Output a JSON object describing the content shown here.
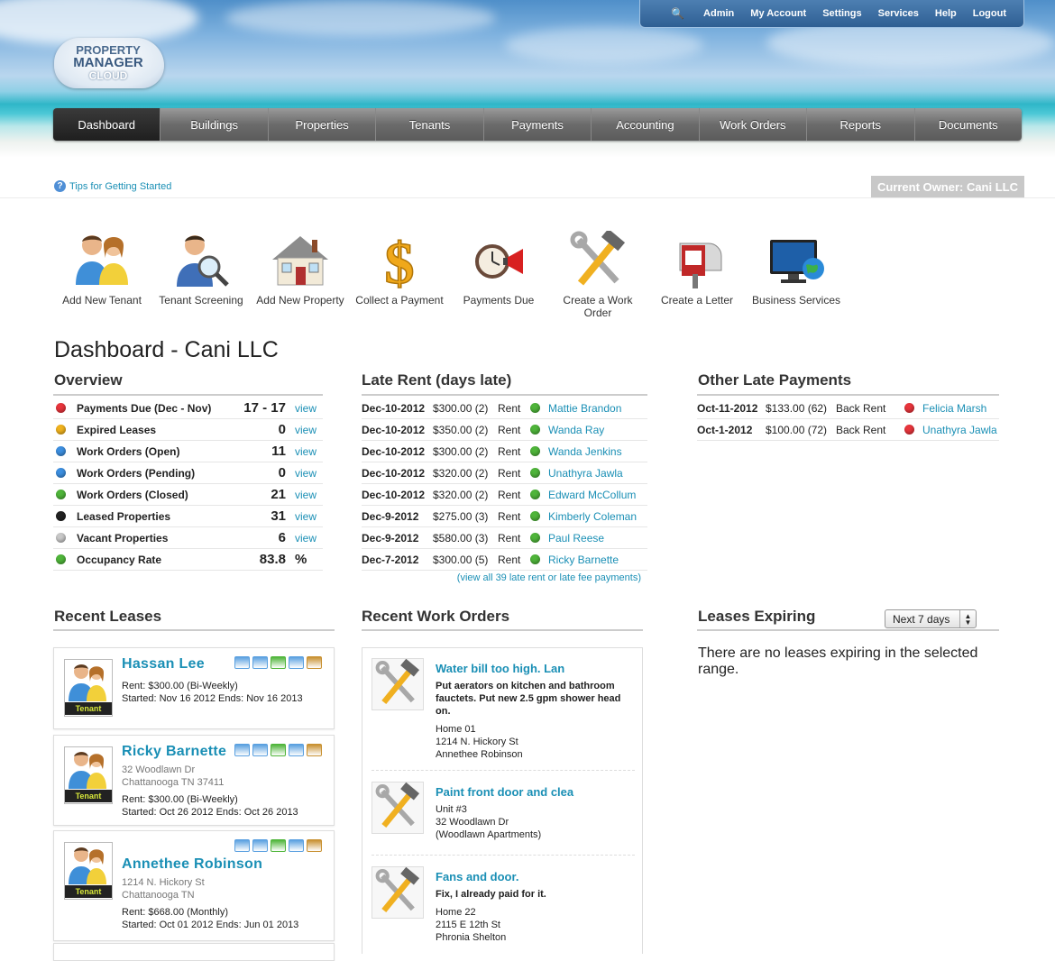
{
  "topbar": {
    "items": [
      "Admin",
      "My Account",
      "Settings",
      "Services",
      "Help",
      "Logout"
    ]
  },
  "logo": {
    "line1": "PROPERTY",
    "line2": "MANAGER",
    "line3": "CLOUD"
  },
  "nav": {
    "items": [
      "Dashboard",
      "Buildings",
      "Properties",
      "Tenants",
      "Payments",
      "Accounting",
      "Work Orders",
      "Reports",
      "Documents"
    ],
    "active": "Dashboard"
  },
  "tips": "Tips for Getting Started",
  "owner": "Current Owner: Cani LLC",
  "quick_actions": [
    "Add New Tenant",
    "Tenant Screening",
    "Add New Property",
    "Collect a Payment",
    "Payments Due",
    "Create a Work Order",
    "Create a Letter",
    "Business Services"
  ],
  "title": "Dashboard - Cani LLC",
  "overview": {
    "heading": "Overview",
    "rows": [
      {
        "label": "Payments Due (Dec - Nov)",
        "value": "17 - 17",
        "link": "view",
        "color": "#e8353c"
      },
      {
        "label": "Expired Leases",
        "value": "0",
        "link": "view",
        "color": "#f0b21e"
      },
      {
        "label": "Work Orders (Open)",
        "value": "11",
        "link": "view",
        "color": "#3d8fe0"
      },
      {
        "label": "Work Orders (Pending)",
        "value": "0",
        "link": "view",
        "color": "#3d8fe0"
      },
      {
        "label": "Work Orders (Closed)",
        "value": "21",
        "link": "view",
        "color": "#4fb53a"
      },
      {
        "label": "Leased Properties",
        "value": "31",
        "link": "view",
        "color": "#222222"
      },
      {
        "label": "Vacant Properties",
        "value": "6",
        "link": "view",
        "color": "#c8c8c8"
      },
      {
        "label": "Occupancy Rate",
        "value": "83.8",
        "link": "%",
        "color": "#4fb53a"
      }
    ]
  },
  "late_rent": {
    "heading": "Late Rent (days late)",
    "rows": [
      {
        "date": "Dec-10-2012",
        "amount": "$300.00 (2)",
        "type": "Rent",
        "name": "Mattie Brandon"
      },
      {
        "date": "Dec-10-2012",
        "amount": "$350.00 (2)",
        "type": "Rent",
        "name": "Wanda Ray"
      },
      {
        "date": "Dec-10-2012",
        "amount": "$300.00 (2)",
        "type": "Rent",
        "name": "Wanda Jenkins"
      },
      {
        "date": "Dec-10-2012",
        "amount": "$320.00 (2)",
        "type": "Rent",
        "name": "Unathyra Jawla"
      },
      {
        "date": "Dec-10-2012",
        "amount": "$320.00 (2)",
        "type": "Rent",
        "name": "Edward McCollum"
      },
      {
        "date": "Dec-9-2012",
        "amount": "$275.00 (3)",
        "type": "Rent",
        "name": "Kimberly Coleman"
      },
      {
        "date": "Dec-9-2012",
        "amount": "$580.00 (3)",
        "type": "Rent",
        "name": "Paul Reese"
      },
      {
        "date": "Dec-7-2012",
        "amount": "$300.00 (5)",
        "type": "Rent",
        "name": "Ricky Barnette"
      }
    ],
    "view_all": "(view all 39 late rent or late fee payments)"
  },
  "other_late": {
    "heading": "Other Late Payments",
    "rows": [
      {
        "date": "Oct-11-2012",
        "amount": "$133.00 (62)",
        "type": "Back Rent",
        "name": "Felicia Marsh"
      },
      {
        "date": "Oct-1-2012",
        "amount": "$100.00 (72)",
        "type": "Back Rent",
        "name": "Unathyra Jawla"
      }
    ]
  },
  "recent_leases": {
    "heading": "Recent Leases",
    "badge": "Tenant",
    "cards": [
      {
        "name": "Hassan  Lee",
        "addr1": "",
        "addr2": "",
        "rent": "Rent: $300.00  (Bi-Weekly)",
        "dates": "Started: Nov 16 2012   Ends: Nov 16 2013"
      },
      {
        "name": "Ricky  Barnette",
        "addr1": "32 Woodlawn Dr",
        "addr2": "Chattanooga TN 37411",
        "rent": "Rent: $300.00  (Bi-Weekly)",
        "dates": "Started: Oct 26 2012   Ends: Oct 26 2013"
      },
      {
        "name": "Annethee  Robinson",
        "addr1": "1214 N. Hickory St",
        "addr2": "Chattanooga TN",
        "rent": "Rent: $668.00  (Monthly)",
        "dates": "Started: Oct 01 2012   Ends: Jun 01 2013"
      }
    ]
  },
  "recent_work_orders": {
    "heading": "Recent Work Orders",
    "items": [
      {
        "title": "Water bill too high. Lan",
        "desc": "Put aerators on kitchen and bathroom fauctets. Put new 2.5 gpm shower head on.",
        "a1": "Home 01",
        "a2": "1214 N. Hickory St",
        "a3": "Annethee Robinson"
      },
      {
        "title": "Paint front door and clea",
        "desc": "",
        "a1": "Unit #3",
        "a2": "32 Woodlawn Dr",
        "a3": "(Woodlawn Apartments)"
      },
      {
        "title": "Fans and door.",
        "desc": "Fix, I already paid for it.",
        "a1": "Home 22",
        "a2": "2115 E 12th St",
        "a3": "Phronia Shelton"
      }
    ]
  },
  "leases_expiring": {
    "heading": "Leases Expiring",
    "select_value": "Next 7 days",
    "empty_text": "There are no leases expiring in the selected range."
  }
}
